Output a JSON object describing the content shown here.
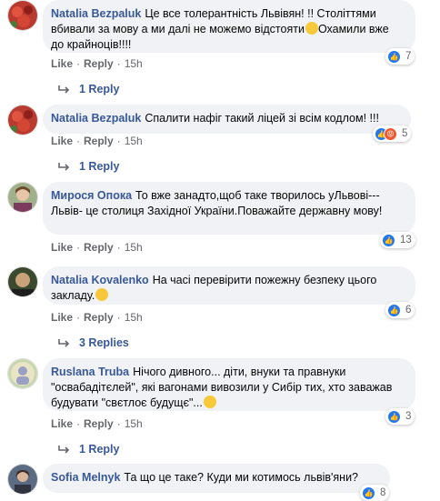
{
  "actions": {
    "like": "Like",
    "reply": "Reply",
    "sep": "·"
  },
  "comments": [
    {
      "author": "Natalia Bezpaluk",
      "text": "Це все толерантність Львівян! !! Століттями вбивали за мову а ми далі не можемо відстояти",
      "text2": "Охамили вже до крайноців!!!!",
      "time": "15h",
      "reaction_count": "7",
      "replies": "1 Reply",
      "reactions": [
        "like-icon"
      ]
    },
    {
      "author": "Natalia Bezpaluk",
      "text": "Спалити нафіг такий ліцей зі всім кодлом! !!!",
      "time": "15h",
      "reaction_count": "5",
      "replies": "1 Reply",
      "reactions": [
        "like-icon",
        "angry-icon"
      ]
    },
    {
      "author": "Мирося Опока",
      "text": "То вже занадто,щоб таке творилось уЛьвові---Львів- це столиця Західної України.Поважайте державну мову!",
      "time": "15h",
      "reaction_count": "13",
      "reactions": [
        "like-icon"
      ]
    },
    {
      "author": "Natalia Kovalenko",
      "text": "На часі перевірити пожежну безпеку цього закладу.",
      "time": "15h",
      "reaction_count": "6",
      "replies": "3 Replies",
      "reactions": [
        "like-icon"
      ]
    },
    {
      "author": "Ruslana Truba",
      "text": "Нічого дивного... діти, внуки та правнуки \"освабадітєлей\", які вагонами вивозили у Сибір тих, хто заважав будувати \"свєтлоє будущє\"...",
      "time": "15h",
      "reaction_count": "3",
      "replies": "1 Reply",
      "reactions": [
        "like-icon"
      ]
    },
    {
      "author": "Sofia Melnyk",
      "text": "Та що це таке? Куди ми котимось львів'яни?",
      "reaction_count": "8",
      "reactions": [
        "like-icon"
      ]
    }
  ],
  "colors": {
    "link": "#385898",
    "bubble": "#f0f2f5",
    "meta": "#65676b",
    "like": "#2078f4",
    "angry": "#f0582e"
  }
}
